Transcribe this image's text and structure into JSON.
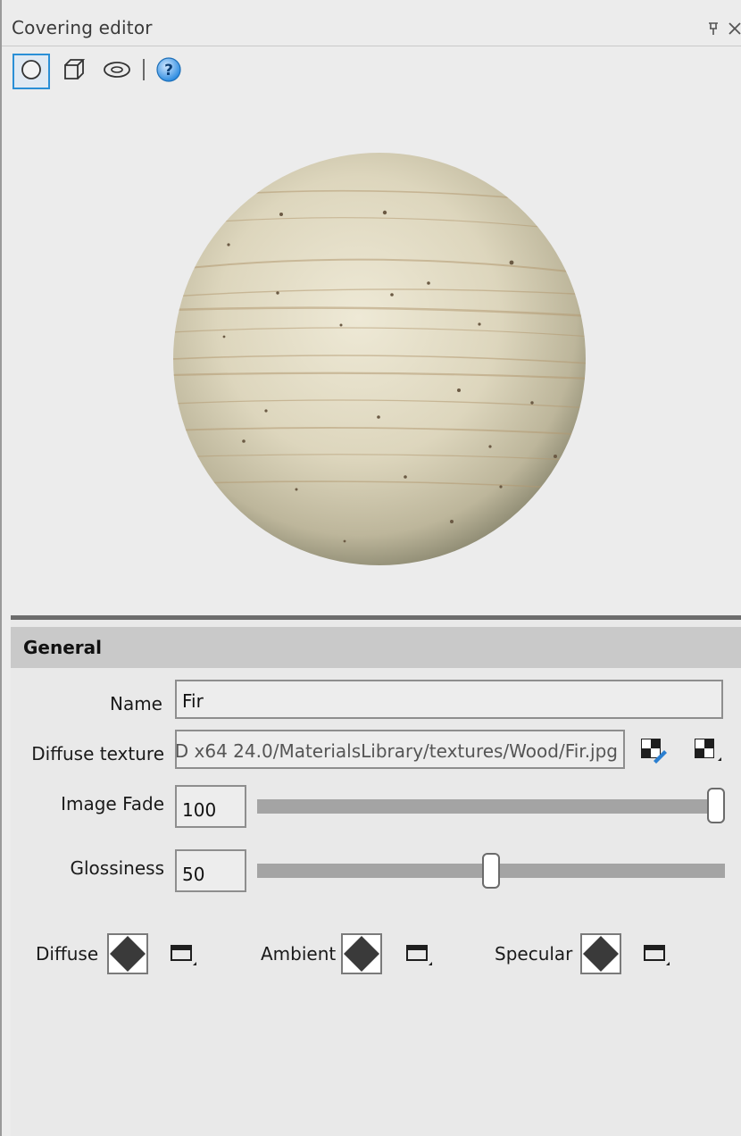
{
  "window": {
    "title": "Covering editor",
    "pin_icon": "pin-icon",
    "close_icon": "close-icon"
  },
  "toolbar": {
    "buttons": [
      {
        "name": "sphere-view",
        "icon": "sphere-icon",
        "active": true
      },
      {
        "name": "cube-view",
        "icon": "cube-icon",
        "active": false
      },
      {
        "name": "torus-view",
        "icon": "torus-icon",
        "active": false
      },
      {
        "name": "help",
        "icon": "help-icon",
        "active": false
      }
    ]
  },
  "preview": {
    "material": "wood",
    "colors": {
      "base": "#e2dcc3",
      "grain": "#b39a72",
      "shade": "#8d8a72",
      "background": "#ececec"
    }
  },
  "section": {
    "title": "General"
  },
  "fields": {
    "name_label": "Name",
    "name_value": "Fir",
    "diffuse_texture_label": "Diffuse texture",
    "diffuse_texture_value": "D x64 24.0/MaterialsLibrary/textures/Wood/Fir.jpg",
    "image_fade_label": "Image Fade",
    "image_fade_value": "100",
    "image_fade_level": 1.0,
    "glossiness_label": "Glossiness",
    "glossiness_value": "50",
    "glossiness_level": 0.5
  },
  "colors": {
    "diffuse_label": "Diffuse",
    "ambient_label": "Ambient",
    "specular_label": "Specular"
  },
  "accent": "#2a8fd6",
  "help_color": "#2b8be0"
}
